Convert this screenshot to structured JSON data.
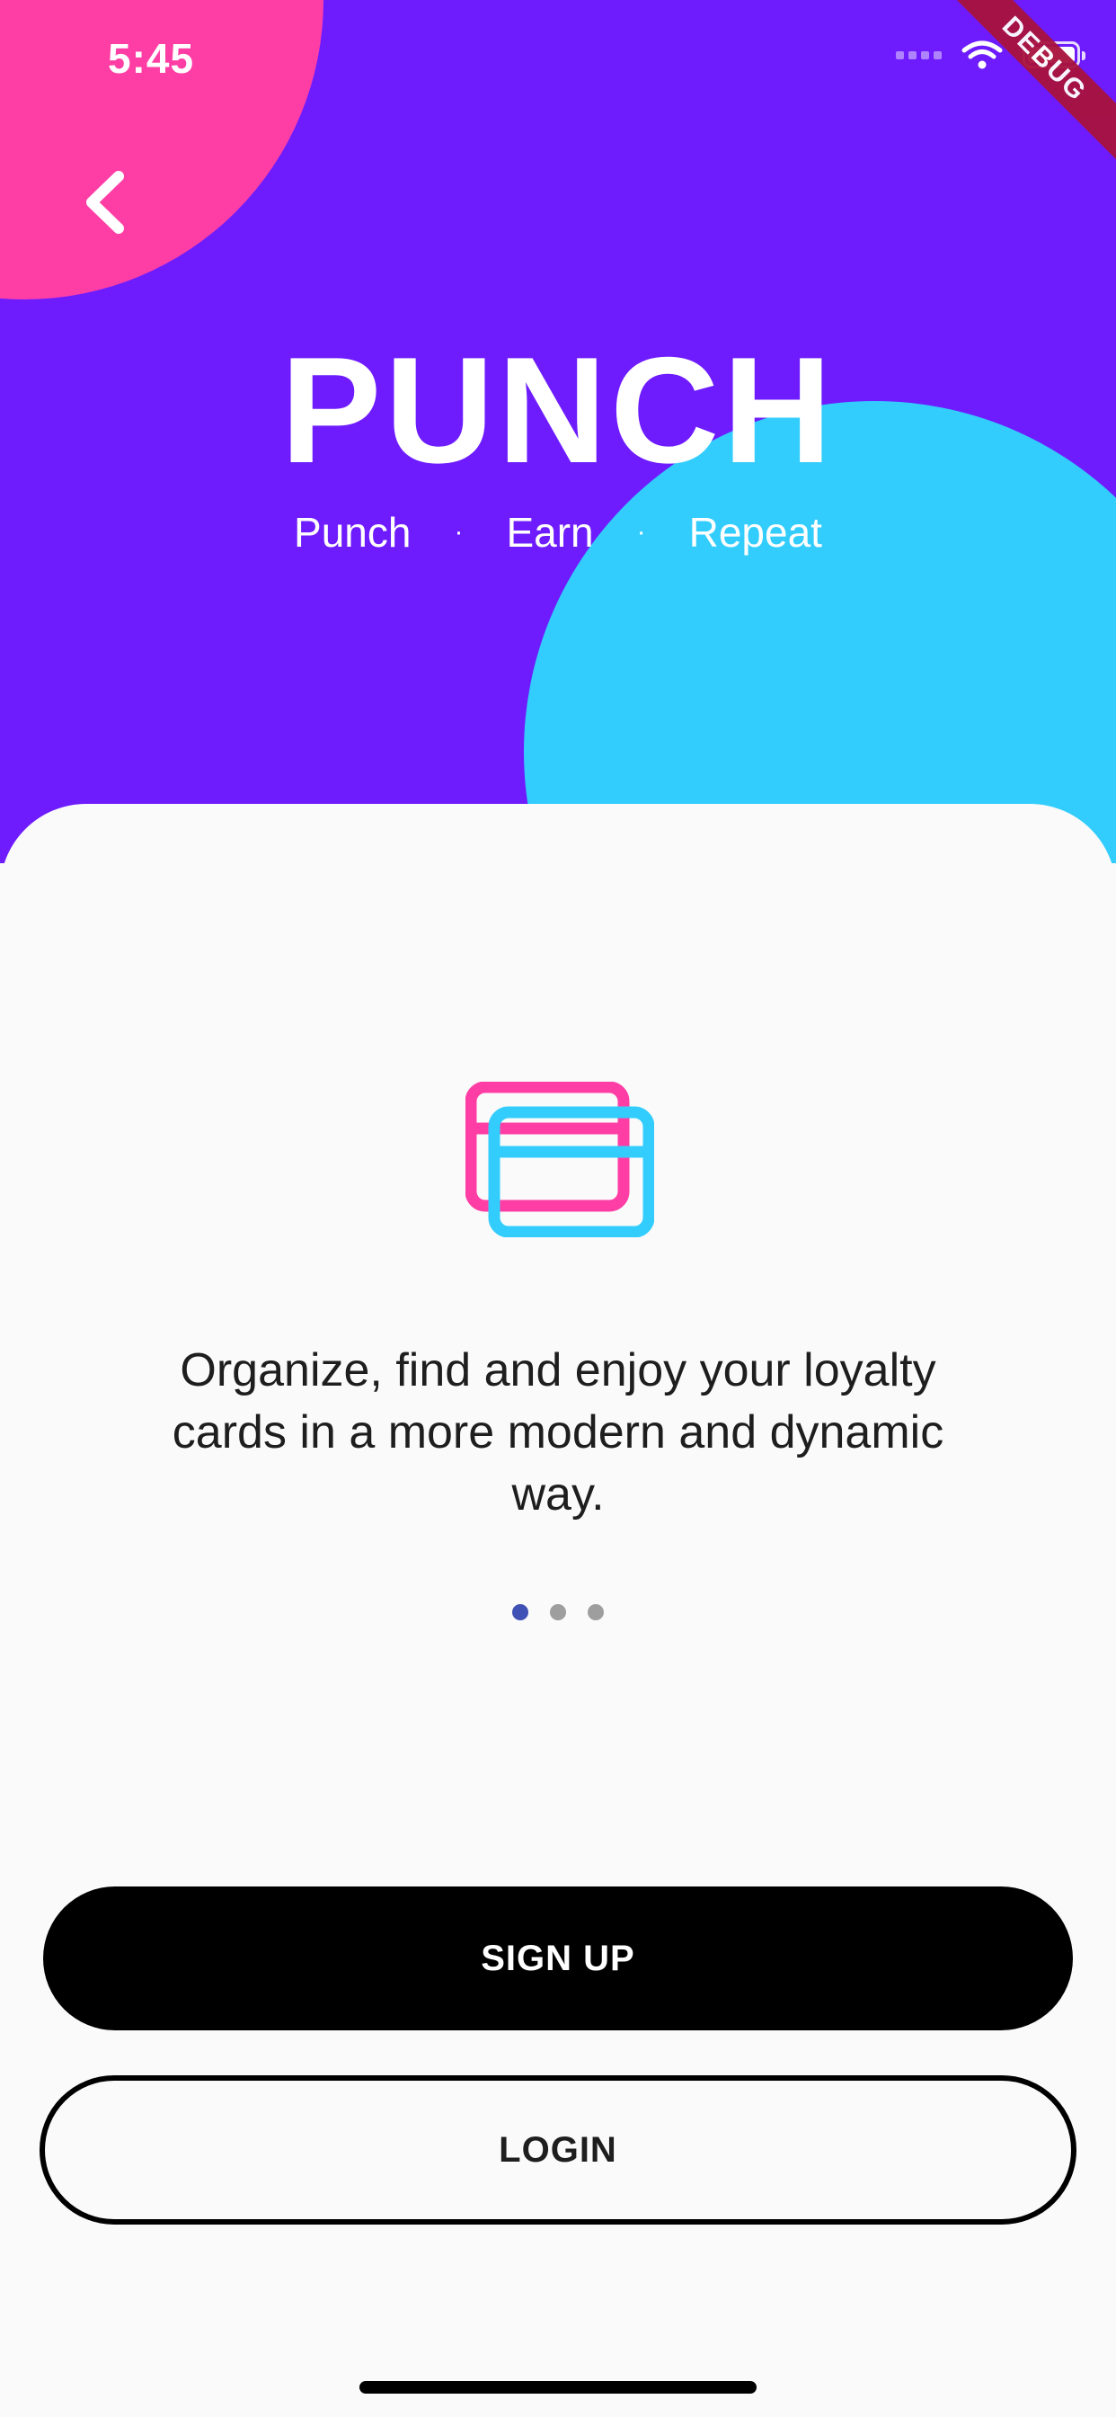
{
  "status_bar": {
    "time": "5:45"
  },
  "debug_banner": "DEBUG",
  "hero": {
    "title": "PUNCH",
    "tagline": [
      "Punch",
      "Earn",
      "Repeat"
    ],
    "tagline_separator": "·"
  },
  "onboarding": {
    "description": "Organize, find and enjoy your loyalty cards in a more modern and dynamic way.",
    "page_indicator": {
      "total": 3,
      "current": 1
    }
  },
  "actions": {
    "signup_label": "SIGN UP",
    "login_label": "LOGIN"
  },
  "colors": {
    "hero_background": "#6e1cfe",
    "circle_pink": "#ff3ea5",
    "circle_blue": "#33cdfd",
    "active_dot": "#3f51b5",
    "inactive_dot": "#9e9e9e"
  },
  "icons": [
    "back-chevron-icon",
    "loyalty-cards-icon",
    "wifi-icon",
    "battery-icon"
  ]
}
